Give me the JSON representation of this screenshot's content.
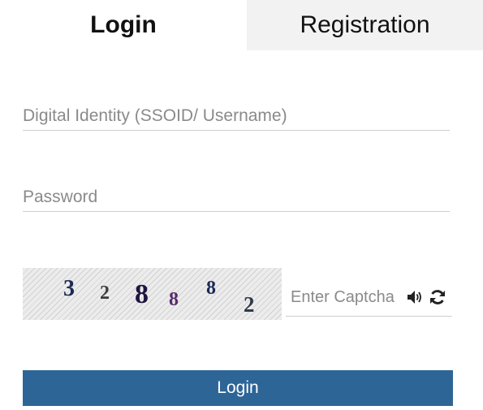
{
  "tabs": {
    "login_label": "Login",
    "registration_label": "Registration"
  },
  "form": {
    "username_placeholder": "Digital Identity (SSOID/ Username)",
    "username_value": "",
    "password_placeholder": "Password",
    "password_value": "",
    "captcha": {
      "chars": [
        "3",
        "2",
        "8",
        "8",
        "8",
        "2"
      ],
      "placeholder": "Enter Captcha",
      "value": "",
      "audio_icon": "speaker-icon",
      "refresh_icon": "refresh-icon"
    },
    "submit_label": "Login"
  },
  "colors": {
    "primary": "#2e6597",
    "tab_inactive_bg": "#f2f2f2",
    "underline": "#cfcfcf"
  }
}
